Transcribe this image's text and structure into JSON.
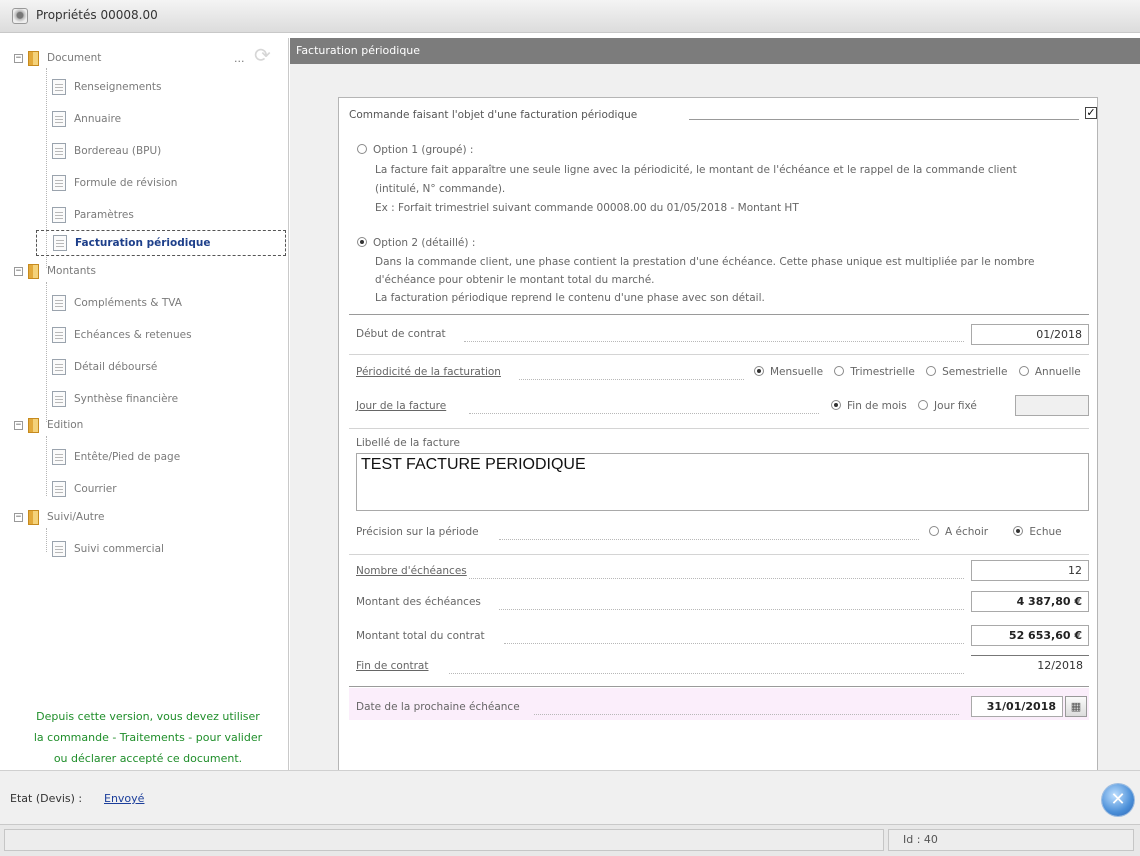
{
  "window": {
    "title": "Propriétés 00008.00"
  },
  "sidebar": {
    "more": "...",
    "groups": [
      {
        "label": "Document",
        "items": [
          "Renseignements",
          "Annuaire",
          "Bordereau (BPU)",
          "Formule de révision",
          "Paramètres",
          "Facturation périodique"
        ]
      },
      {
        "label": "Montants",
        "items": [
          "Compléments & TVA",
          "Echéances & retenues",
          "Détail déboursé",
          "Synthèse financière"
        ]
      },
      {
        "label": "Edition",
        "items": [
          "Entête/Pied de page",
          "Courrier"
        ]
      },
      {
        "label": "Suivi/Autre",
        "items": [
          "Suivi commercial"
        ]
      }
    ],
    "notice": [
      "Depuis cette version, vous devez utiliser",
      "la commande - Traitements - pour valider",
      "ou déclarer accepté ce document."
    ]
  },
  "main": {
    "header": "Facturation périodique",
    "section_title": "Commande faisant l'objet d'une facturation périodique",
    "section_checked": true,
    "option1": {
      "label": "Option 1 (groupé) :",
      "line1": "La facture fait apparaître une seule ligne avec la périodicité, le montant de l'échéance et le rappel de la commande client",
      "line2": "(intitulé, N° commande).",
      "line3": "Ex : Forfait trimestriel suivant commande 00008.00 du 01/05/2018 - Montant HT"
    },
    "option2": {
      "label": "Option 2 (détaillé) :",
      "line1": "Dans la commande client, une phase contient la prestation d'une échéance. Cette phase unique est multipliée par le nombre",
      "line2": "d'échéance pour obtenir le montant total du marché.",
      "line3": "La facturation périodique reprend le contenu d'une phase avec son détail."
    },
    "debut_contrat": {
      "label": "Début de contrat",
      "value": "01/2018"
    },
    "periodicite": {
      "label": "Périodicité de la facturation",
      "options": [
        "Mensuelle",
        "Trimestrielle",
        "Semestrielle",
        "Annuelle"
      ],
      "selected": "Mensuelle"
    },
    "jour_facture": {
      "label": "Jour de la facture",
      "options": [
        "Fin de mois",
        "Jour fixé"
      ],
      "selected": "Fin de mois"
    },
    "libelle": {
      "label": "Libellé de la facture",
      "value": "TEST FACTURE PERIODIQUE"
    },
    "precision": {
      "label": "Précision sur la période",
      "options": [
        "A échoir",
        "Echue"
      ],
      "selected": "Echue"
    },
    "nb_echeances": {
      "label": "Nombre d'échéances",
      "value": "12"
    },
    "montant_echeances": {
      "label": "Montant des échéances",
      "value": "4 387,80 €"
    },
    "montant_total": {
      "label": "Montant total du contrat",
      "value": "52 653,60 €"
    },
    "fin_contrat": {
      "label": "Fin de contrat",
      "value": "12/2018"
    },
    "prochaine_echeance": {
      "label": "Date de la prochaine échéance",
      "value": "31/01/2018"
    }
  },
  "status": {
    "label": "Etat (Devis) :",
    "link": "Envoyé",
    "id_text": "Id : 40"
  }
}
